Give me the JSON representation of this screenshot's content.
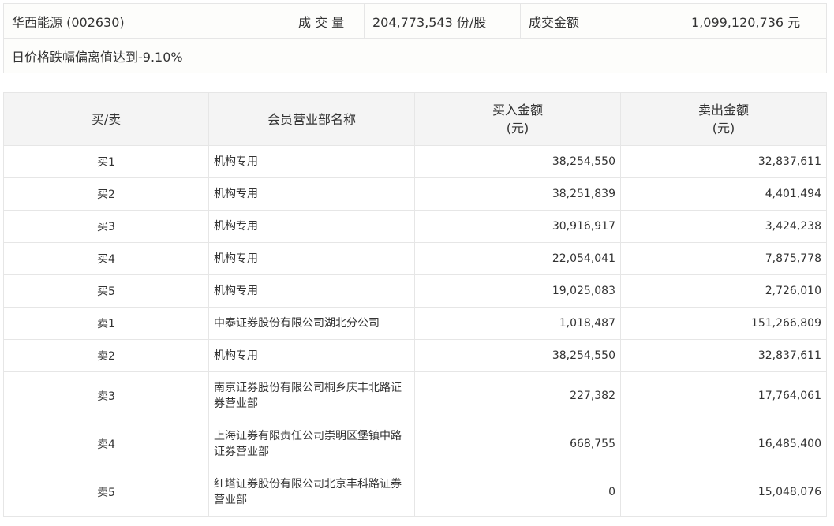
{
  "summary": {
    "stock_name": "华西能源 (002630)",
    "volume_label": "成 交 量",
    "volume_value": "204,773,543 份/股",
    "amount_label": "成交金额",
    "amount_value": "1,099,120,736 元",
    "note": "日价格跌幅偏离值达到-9.10%"
  },
  "table": {
    "headers": {
      "side": "买/卖",
      "member": "会员营业部名称",
      "buy": "买入金额",
      "buy_unit": "(元)",
      "sell": "卖出金额",
      "sell_unit": "(元)"
    },
    "rows": [
      {
        "side": "买1",
        "member": "机构专用",
        "buy": "38,254,550",
        "sell": "32,837,611"
      },
      {
        "side": "买2",
        "member": "机构专用",
        "buy": "38,251,839",
        "sell": "4,401,494"
      },
      {
        "side": "买3",
        "member": "机构专用",
        "buy": "30,916,917",
        "sell": "3,424,238"
      },
      {
        "side": "买4",
        "member": "机构专用",
        "buy": "22,054,041",
        "sell": "7,875,778"
      },
      {
        "side": "买5",
        "member": "机构专用",
        "buy": "19,025,083",
        "sell": "2,726,010"
      },
      {
        "side": "卖1",
        "member": "中泰证券股份有限公司湖北分公司",
        "buy": "1,018,487",
        "sell": "151,266,809"
      },
      {
        "side": "卖2",
        "member": "机构专用",
        "buy": "38,254,550",
        "sell": "32,837,611"
      },
      {
        "side": "卖3",
        "member": "南京证券股份有限公司桐乡庆丰北路证券营业部",
        "buy": "227,382",
        "sell": "17,764,061"
      },
      {
        "side": "卖4",
        "member": "上海证券有限责任公司崇明区堡镇中路证券营业部",
        "buy": "668,755",
        "sell": "16,485,400"
      },
      {
        "side": "卖5",
        "member": "红塔证券股份有限公司北京丰科路证券营业部",
        "buy": "0",
        "sell": "15,048,076"
      }
    ]
  }
}
